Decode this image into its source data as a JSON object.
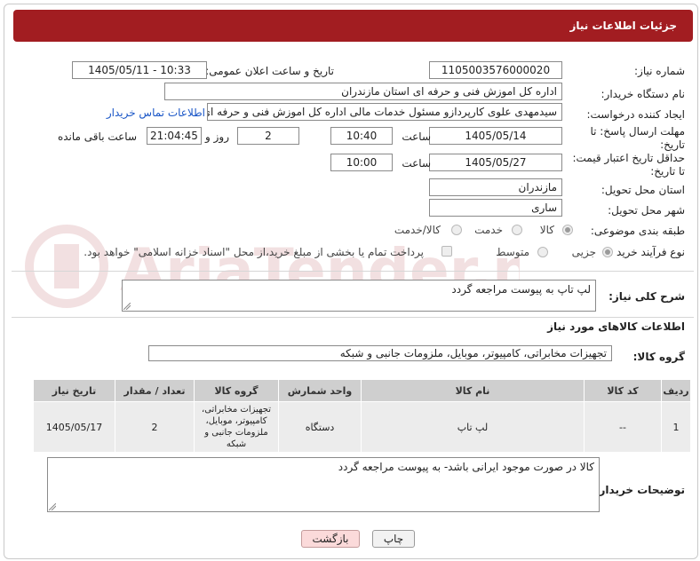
{
  "header": {
    "title": "جزئیات اطلاعات نیاز"
  },
  "fields": {
    "need_number_label": "شماره نیاز:",
    "need_number": "1105003576000020",
    "announce_label": "تاریخ و ساعت اعلان عمومی:",
    "announce_value": "1405/05/11 - 10:33",
    "buyer_label": "نام دستگاه خریدار:",
    "buyer_value": "اداره کل اموزش فنی و حرفه ای استان مازندران",
    "creator_label": "ایجاد کننده درخواست:",
    "creator_value": "سیدمهدی  علوی کارپردازو مسئول خدمات مالی اداره کل اموزش فنی و حرفه ای",
    "contact_link": "اطلاعات تماس خریدار",
    "deadline_label": "مهلت ارسال پاسخ: تا تاریخ:",
    "deadline_date": "1405/05/14",
    "time_label": "ساعت",
    "deadline_time": "10:40",
    "days_value": "2",
    "days_label": "روز و",
    "remaining_time": "21:04:45",
    "remaining_label": "ساعت باقی مانده",
    "price_label": "حداقل تاریخ اعتبار قیمت: تا تاریخ:",
    "price_date": "1405/05/27",
    "price_time": "10:00",
    "province_label": "استان محل تحویل:",
    "province_value": "مازندران",
    "city_label": "شهر محل تحویل:",
    "city_value": "ساری",
    "category_label": "طبقه بندی موضوعی:",
    "category_options": [
      "کالا",
      "خدمت",
      "کالا/خدمت"
    ],
    "process_label": "نوع فرآیند خرید :",
    "process_options": [
      "جزیی",
      "متوسط"
    ],
    "payment_note": "پرداخت تمام یا بخشی از مبلغ خرید،از محل \"اسناد خزانه اسلامی\" خواهد بود."
  },
  "summary": {
    "label": "شرح کلی نیاز:",
    "value": "لپ تاپ به پیوست مراجعه گردد"
  },
  "goods_section": {
    "title": "اطلاعات کالاهای مورد نیاز",
    "group_label": "گروه کالا:",
    "group_value": "تجهیزات مخابراتی، کامپیوتر، موبایل، ملزومات جانبی و شبکه"
  },
  "table": {
    "headers": [
      "ردیف",
      "کد کالا",
      "نام کالا",
      "واحد شمارش",
      "گروه کالا",
      "تعداد / مقدار",
      "تاریخ نیاز"
    ],
    "rows": [
      [
        "1",
        "--",
        "لپ تاپ",
        "دستگاه",
        "تجهیزات مخابراتی، کامپیوتر، موبایل، ملزومات جانبی و شبکه",
        "2",
        "1405/05/17"
      ]
    ]
  },
  "buyer_notes": {
    "label": "توضیحات خریدار:",
    "value": "کالا در صورت موجود ایرانی باشد- به پیوست مراجعه گردد"
  },
  "buttons": {
    "print": "چاپ",
    "back": "بازگشت"
  },
  "watermark": {
    "text": "AriaTender.net"
  }
}
